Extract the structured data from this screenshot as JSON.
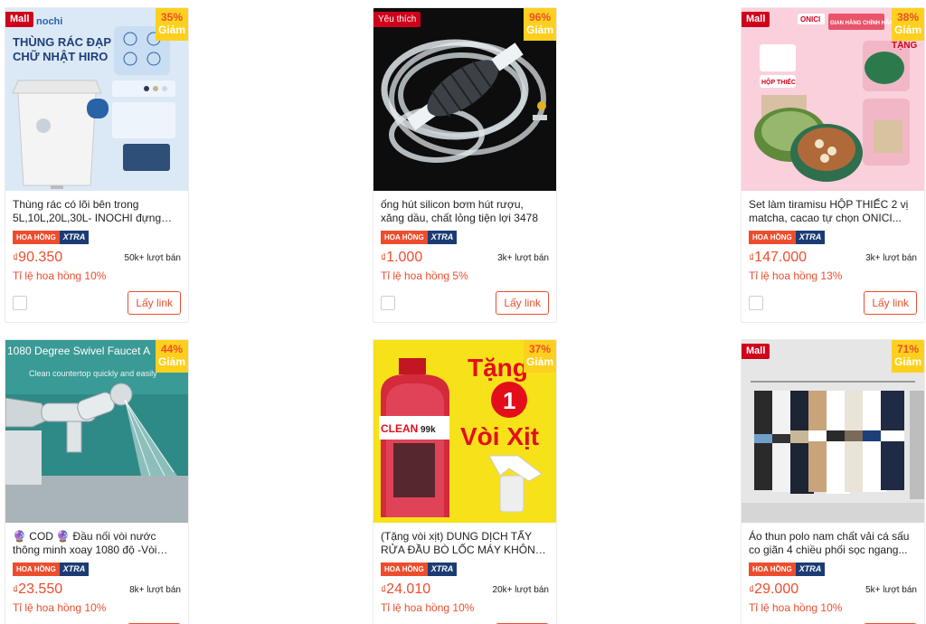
{
  "common": {
    "commission_badge_left": "HOA HỒNG",
    "commission_badge_right": "XTRA",
    "get_link_label": "Lấy link",
    "discount_label": "Giảm",
    "currency": "₫"
  },
  "products": [
    {
      "badge": "Mall",
      "discount": "35%",
      "image_text": {
        "line1": "THÙNG RÁC ĐẠP",
        "line2": "CHỮ NHẬT HIRO",
        "brand": "nochi"
      },
      "title": "Thùng rác có lõi bên trong 5L,10L,20L,30L- INOCHI đựng Rá...",
      "price": "90.350",
      "sold": "50k+ lượt bán",
      "rate": "Tỉ lệ hoa hồng 10%"
    },
    {
      "badge": "Yêu thích",
      "discount": "96%",
      "title": "ống hút silicon bơm hút rượu, xăng dầu, chất lỏng tiện lợi 3478",
      "price": "1.000",
      "sold": "3k+ lượt bán",
      "rate": "Tỉ lệ hoa hồng 5%"
    },
    {
      "badge": "Mall",
      "discount": "38%",
      "image_text": {
        "brand": "ONICI",
        "store": "GIAN HÀNG CHÍNH HÃNG",
        "gift": "TẶNG",
        "box": "HỘP THIẾC"
      },
      "title": "Set làm tiramisu HỘP THIẾC 2 vị matcha, cacao tự chọn ONICI...",
      "price": "147.000",
      "sold": "3k+ lượt bán",
      "rate": "Tỉ lệ hoa hồng 13%"
    },
    {
      "discount": "44%",
      "image_text": {
        "line1": "1080 Degree Swivel Faucet A",
        "line2": "Clean countertop quickly and easily"
      },
      "title": "🔮 COD 🔮 Đầu nối vòi nước thông minh xoay 1080 độ -Vòi nước lập...",
      "price": "23.550",
      "sold": "8k+ lượt bán",
      "rate": "Tỉ lệ hoa hồng 10%"
    },
    {
      "discount": "37%",
      "image_text": {
        "line1": "Tặng",
        "num": "1",
        "line2": "Vòi Xịt",
        "label": "CLEAN",
        "price_tag": "99k"
      },
      "title": "(Tặng vòi xịt) DUNG DỊCH TẨY RỬA ĐẦU BÒ LỐC MÁY KHÔNG CHẠM...",
      "price": "24.010",
      "sold": "20k+ lượt bán",
      "rate": "Tỉ lệ hoa hồng 10%"
    },
    {
      "badge": "Mall",
      "discount": "71%",
      "title": "Áo thun polo nam chất vải cá sấu co giãn 4 chiều phối sọc ngang...",
      "price": "29.000",
      "sold": "5k+ lượt bán",
      "rate": "Tỉ lệ hoa hồng 10%"
    }
  ]
}
